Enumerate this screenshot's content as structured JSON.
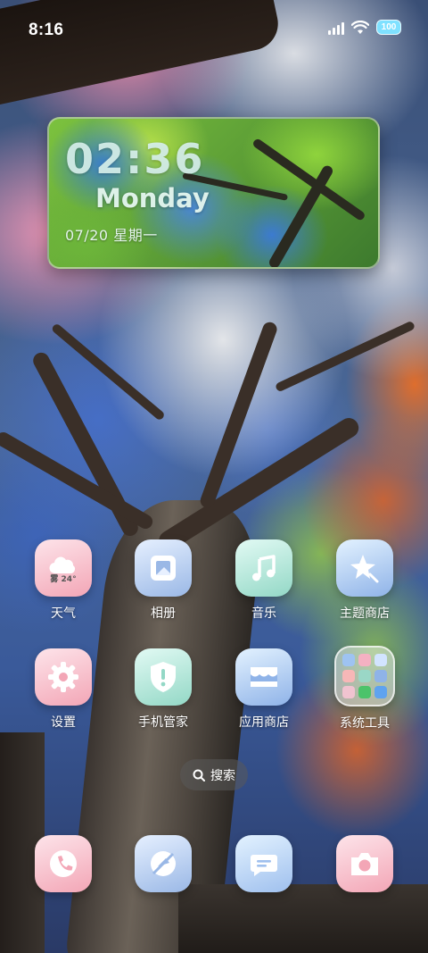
{
  "status_bar": {
    "time": "8:16",
    "battery": "100"
  },
  "clock_widget": {
    "time": "02:36",
    "day": "Monday",
    "date": "07/20 星期一"
  },
  "apps_row1": [
    {
      "label": "天气",
      "icon": "weather-icon",
      "badge": "雾 24°"
    },
    {
      "label": "相册",
      "icon": "gallery-icon"
    },
    {
      "label": "音乐",
      "icon": "music-icon"
    },
    {
      "label": "主题商店",
      "icon": "theme-store-icon"
    }
  ],
  "apps_row2": [
    {
      "label": "设置",
      "icon": "settings-icon"
    },
    {
      "label": "手机管家",
      "icon": "phone-manager-icon"
    },
    {
      "label": "应用商店",
      "icon": "app-store-icon"
    },
    {
      "label": "系统工具",
      "icon": "folder-icon"
    }
  ],
  "search": {
    "label": "搜索"
  },
  "dock": [
    {
      "icon": "phone-icon"
    },
    {
      "icon": "browser-icon"
    },
    {
      "icon": "messages-icon"
    },
    {
      "icon": "camera-icon"
    }
  ],
  "colors": {
    "pink_icon": "#f3a6b6",
    "blue_icon": "#9ab8e6",
    "teal_icon": "#93d8c6"
  }
}
